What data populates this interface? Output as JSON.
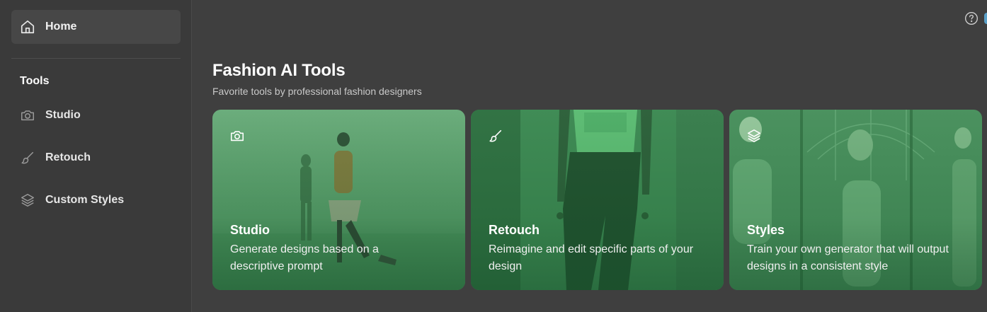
{
  "sidebar": {
    "home": {
      "label": "Home",
      "icon": "home-icon"
    },
    "section_title": "Tools",
    "items": [
      {
        "label": "Studio",
        "icon": "camera-icon"
      },
      {
        "label": "Retouch",
        "icon": "brush-icon"
      },
      {
        "label": "Custom Styles",
        "icon": "layers-icon"
      }
    ]
  },
  "header": {
    "help_icon": "help-circle-icon"
  },
  "main": {
    "title": "Fashion AI Tools",
    "subtitle": "Favorite tools by professional fashion designers",
    "cards": [
      {
        "title": "Studio",
        "description": "Generate designs based on a descriptive prompt",
        "icon": "camera-icon"
      },
      {
        "title": "Retouch",
        "description": "Reimagine and edit specific parts of your design",
        "icon": "brush-icon"
      },
      {
        "title": "Styles",
        "description": "Train your own generator that will output designs in a consistent style",
        "icon": "layers-icon"
      }
    ]
  },
  "colors": {
    "background": "#3f3f3f",
    "sidebar": "#3a3a3a",
    "active_nav": "#474747",
    "card_green": "#4e9a62"
  }
}
